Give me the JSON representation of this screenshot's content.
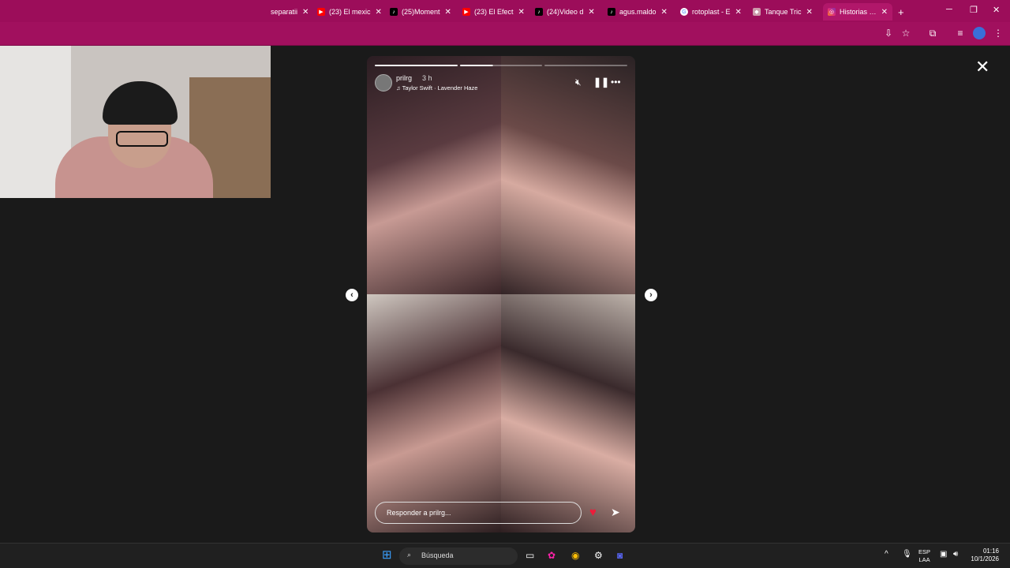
{
  "browser": {
    "tabs": [
      {
        "label": "separatii",
        "icon": ""
      },
      {
        "label": "(23) El mexic",
        "icon": "youtube-icon"
      },
      {
        "label": "(25)Moment",
        "icon": "tiktok-icon"
      },
      {
        "label": "(23) El Efect",
        "icon": "youtube-icon"
      },
      {
        "label": "(24)Video d",
        "icon": "tiktok-icon"
      },
      {
        "label": "agus.maldo",
        "icon": "tiktok-icon"
      },
      {
        "label": "rotoplast - E",
        "icon": "google-icon"
      },
      {
        "label": "Tanque Tric",
        "icon": "store-icon"
      },
      {
        "label": "Historias • In",
        "icon": "instagram-icon"
      }
    ],
    "new_tab": "+",
    "accent": "#9c0d5a"
  },
  "story": {
    "username": "prilrg",
    "time": "3 h",
    "song": "Taylor Swift · Lavender Haze",
    "reply_placeholder": "Responder a prilrg...",
    "progress_segments": 3,
    "current_segment": 2
  },
  "taskbar": {
    "search_label": "Búsqueda",
    "lang_top": "ESP",
    "lang_bottom": "LAA",
    "time": "01:16",
    "date": "10/1/2026"
  }
}
